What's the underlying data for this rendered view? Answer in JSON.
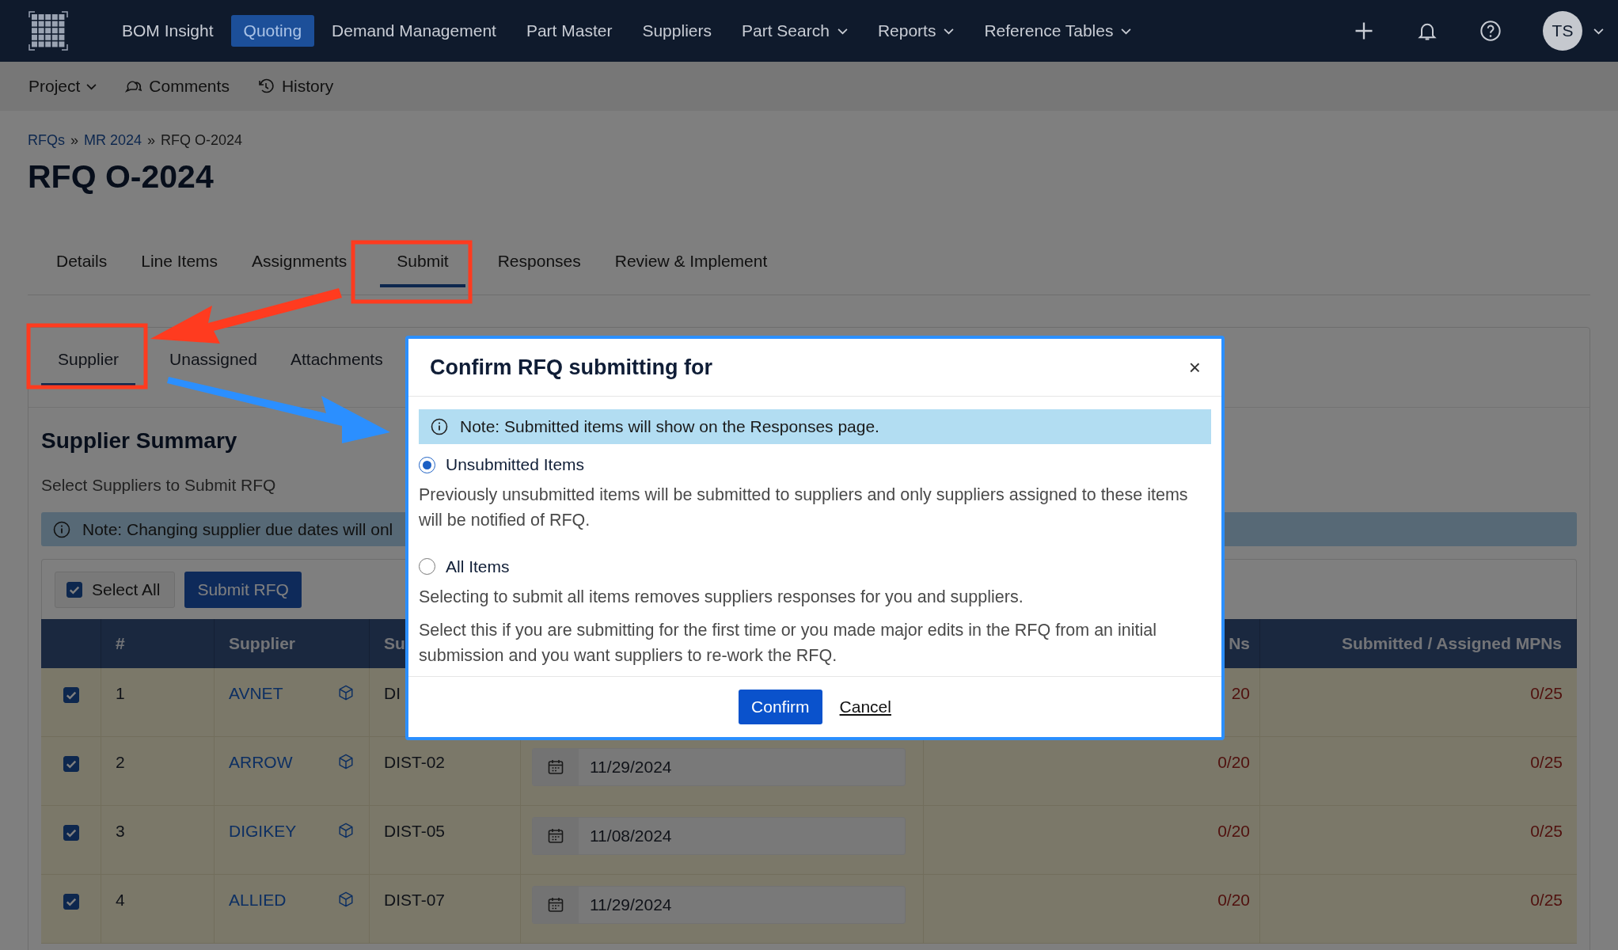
{
  "nav": {
    "items": [
      {
        "label": "BOM Insight",
        "selected": false,
        "dropdown": false
      },
      {
        "label": "Quoting",
        "selected": true,
        "dropdown": false
      },
      {
        "label": "Demand Management",
        "selected": false,
        "dropdown": false
      },
      {
        "label": "Part Master",
        "selected": false,
        "dropdown": false
      },
      {
        "label": "Suppliers",
        "selected": false,
        "dropdown": false
      },
      {
        "label": "Part Search",
        "selected": false,
        "dropdown": true
      },
      {
        "label": "Reports",
        "selected": false,
        "dropdown": true
      },
      {
        "label": "Reference Tables",
        "selected": false,
        "dropdown": true
      }
    ],
    "avatar": "TS"
  },
  "toolbar": [
    {
      "label": "Project",
      "kind": "dropdown"
    },
    {
      "label": "Comments",
      "kind": "comments"
    },
    {
      "label": "History",
      "kind": "history"
    }
  ],
  "breadcrumb": [
    {
      "label": "RFQs",
      "kind": "link"
    },
    {
      "label": "»",
      "kind": "separator"
    },
    {
      "label": "MR 2024",
      "kind": "link"
    },
    {
      "label": "»",
      "kind": "separator"
    },
    {
      "label": "RFQ O-2024",
      "kind": "current"
    }
  ],
  "title": "RFQ O-2024",
  "tabs": [
    {
      "label": "Details",
      "selected": false
    },
    {
      "label": "Line Items",
      "selected": false
    },
    {
      "label": "Assignments",
      "selected": false
    },
    {
      "label": "Submit",
      "selected": true
    },
    {
      "label": "Responses",
      "selected": false
    },
    {
      "label": "Review & Implement",
      "selected": false
    }
  ],
  "subtabs": [
    {
      "label": "Supplier",
      "selected": true
    },
    {
      "label": "Unassigned",
      "selected": false
    },
    {
      "label": "Attachments",
      "selected": false
    }
  ],
  "section": {
    "title": "Supplier Summary",
    "subtitle": "Select Suppliers to Submit RFQ",
    "note": "Note: Changing supplier due dates will onl"
  },
  "actions": {
    "select_all": {
      "label": "Select All",
      "checked": true
    },
    "submit": "Submit RFQ"
  },
  "table": {
    "columns": [
      "#",
      "Supplier",
      "Su",
      "",
      "Ns",
      "Submitted / Assigned MPNs"
    ],
    "rows": [
      {
        "checked": true,
        "number": "1",
        "supplier": "AVNET",
        "code": "DI",
        "mpns": "20",
        "submitted": "0/25"
      },
      {
        "checked": true,
        "number": "2",
        "supplier": "ARROW",
        "code": "DIST-02",
        "date": "11/29/2024",
        "mpns": "0/20",
        "submitted": "0/25"
      },
      {
        "checked": true,
        "number": "3",
        "supplier": "DIGIKEY",
        "code": "DIST-05",
        "date": "11/08/2024",
        "mpns": "0/20",
        "submitted": "0/25"
      },
      {
        "checked": true,
        "number": "4",
        "supplier": "ALLIED",
        "code": "DIST-07",
        "date": "11/29/2024",
        "mpns": "0/20",
        "submitted": "0/25"
      }
    ]
  },
  "dialog": {
    "title": "Confirm RFQ submitting for",
    "close": "×",
    "note": "Note: Submitted items will show on the Responses page.",
    "options": [
      {
        "label": "Unsubmitted Items",
        "selected": true,
        "descriptions": [
          "Previously unsubmitted items will be submitted to suppliers and only suppliers assigned to these items will be notified of RFQ."
        ]
      },
      {
        "label": "All Items",
        "selected": false,
        "descriptions": [
          "Selecting to submit all items removes suppliers responses for you and suppliers.",
          "Select this if you are submitting for the first time or you made major edits in the RFQ from an initial submission and you want suppliers to re-work the RFQ."
        ]
      }
    ],
    "confirm": "Confirm",
    "cancel": "Cancel"
  }
}
